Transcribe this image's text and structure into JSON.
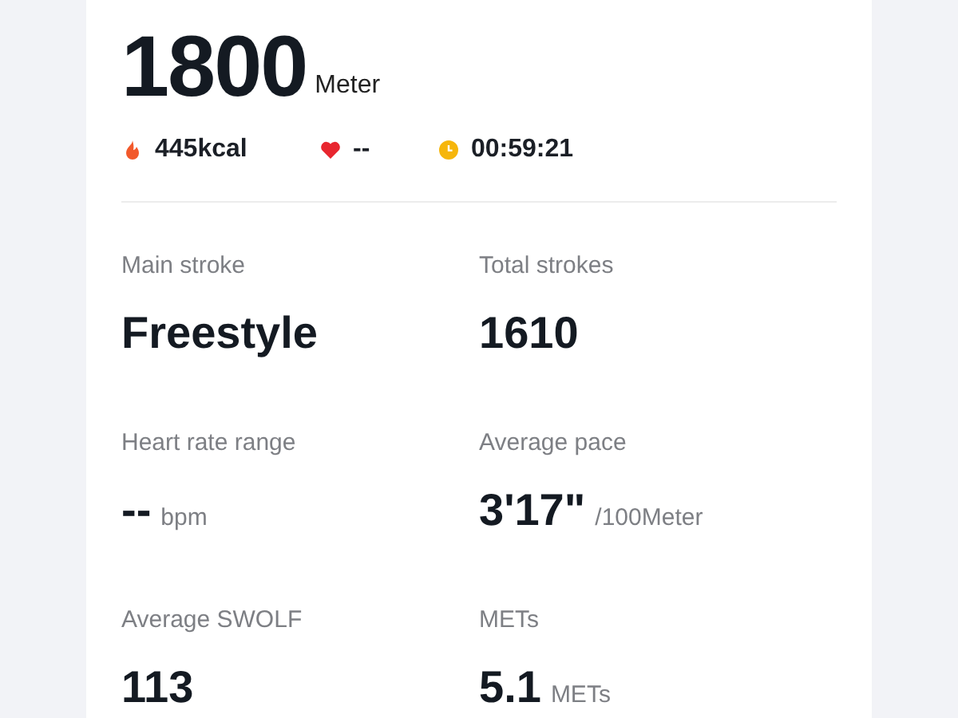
{
  "distance": {
    "value": "1800",
    "unit": "Meter"
  },
  "summary": [
    {
      "kind": "calories",
      "text": "445kcal"
    },
    {
      "kind": "heart",
      "text": "--"
    },
    {
      "kind": "duration",
      "text": "00:59:21"
    }
  ],
  "metrics": [
    {
      "label": "Main stroke",
      "value": "Freestyle"
    },
    {
      "label": "Total strokes",
      "value": "1610"
    },
    {
      "label": "Heart rate range",
      "value": "--",
      "unit": "bpm"
    },
    {
      "label": "Average pace",
      "value": "3'17\"",
      "unit": "/100Meter"
    },
    {
      "label": "Average SWOLF",
      "value": "113"
    },
    {
      "label": "METs",
      "value": "5.1",
      "unit": "METs"
    }
  ]
}
